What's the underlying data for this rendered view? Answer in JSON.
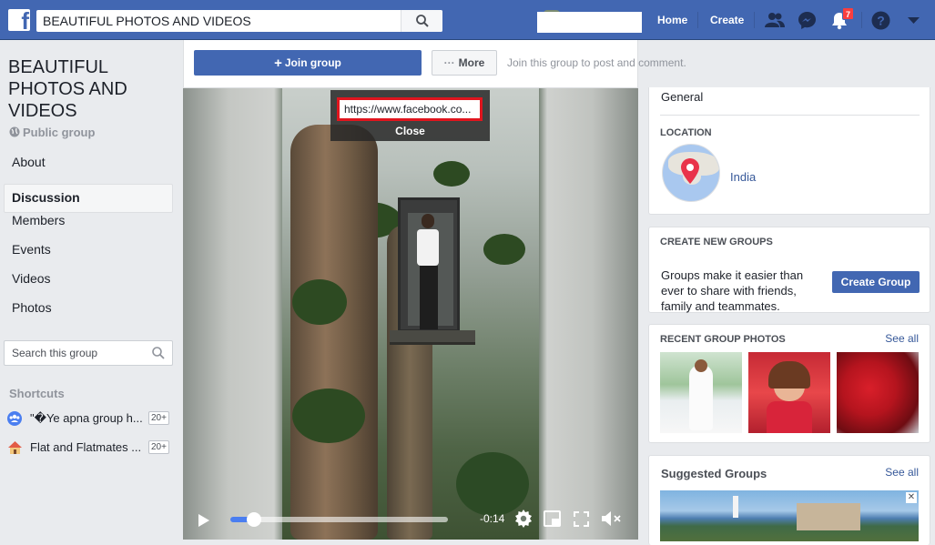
{
  "topbar": {
    "search_value": "BEAUTIFUL PHOTOS AND VIDEOS",
    "nav_home": "Home",
    "nav_create": "Create",
    "notification_count": "7",
    "brand_color": "#4267b2"
  },
  "group": {
    "title": "BEAUTIFUL PHOTOS AND VIDEOS",
    "privacy": "Public group"
  },
  "sidebar": {
    "items": [
      {
        "label": "About"
      },
      {
        "label": "Discussion"
      },
      {
        "label": "Members"
      },
      {
        "label": "Events"
      },
      {
        "label": "Videos"
      },
      {
        "label": "Photos"
      }
    ],
    "search_placeholder": "Search this group",
    "shortcuts_title": "Shortcuts",
    "shortcuts": [
      {
        "label": "\"�Ye apna group h...",
        "count": "20+"
      },
      {
        "label": "Flat and Flatmates ...",
        "count": "20+"
      }
    ]
  },
  "join_bar": {
    "join_label": "Join group",
    "more_label": "More",
    "hint": "Join this group to post and comment."
  },
  "video": {
    "url_value": "https://www.facebook.co...",
    "close_label": "Close",
    "time_remaining": "-0:14",
    "progress": 0.11
  },
  "about_card": {
    "category": "General",
    "location_heading": "LOCATION",
    "location": "India"
  },
  "create_groups": {
    "heading": "CREATE NEW GROUPS",
    "text": "Groups make it easier than ever to share with friends, family and teammates.",
    "button_label": "Create Group"
  },
  "recent_photos": {
    "heading": "RECENT GROUP PHOTOS",
    "see_all": "See all"
  },
  "suggested": {
    "heading": "Suggested Groups",
    "see_all": "See all",
    "close_glyph": "✕"
  }
}
